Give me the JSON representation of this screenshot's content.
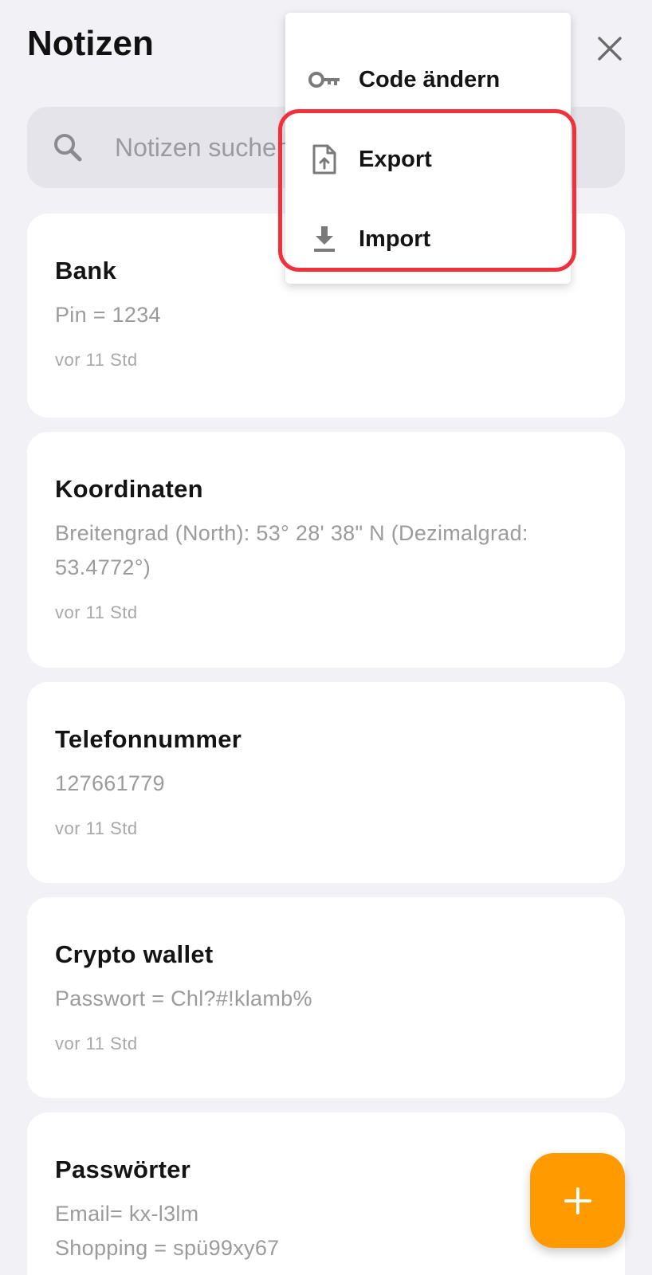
{
  "header": {
    "title": "Notizen"
  },
  "search": {
    "placeholder": "Notizen suchen"
  },
  "menu": {
    "items": [
      {
        "label": "Code ändern",
        "icon": "key-icon"
      },
      {
        "label": "Export",
        "icon": "file-upload-icon"
      },
      {
        "label": "Import",
        "icon": "download-icon"
      }
    ]
  },
  "notes": [
    {
      "title": "Bank",
      "body": "Pin = 1234",
      "time": "vor 11 Std"
    },
    {
      "title": "Koordinaten",
      "body": "Breitengrad (North): 53° 28' 38\" N (Dezimalgrad: 53.4772°)",
      "time": "vor 11 Std"
    },
    {
      "title": "Telefonnummer",
      "body": "127661779",
      "time": "vor 11 Std"
    },
    {
      "title": "Crypto wallet",
      "body": "Passwort = Chl?#!klamb%",
      "time": "vor 11 Std"
    },
    {
      "title": "Passwörter",
      "body": "Email= kx-l3lm\nShopping = spü99xy67",
      "time": ""
    }
  ],
  "colors": {
    "background": "#f1f1f6",
    "accent": "#ff9b00",
    "highlight": "#f0313c"
  }
}
